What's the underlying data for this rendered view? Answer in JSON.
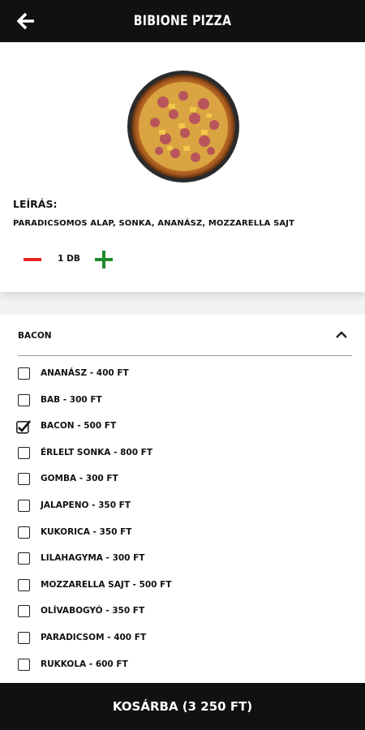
{
  "header": {
    "title": "BIBIONE PIZZA",
    "back_icon": "arrow-left-icon"
  },
  "product": {
    "image_icon": "pizza-photo",
    "description_label": "LEÍRÁS:",
    "description": "PARADICSOMOS ALAP, SONKA, ANANÁSZ, MOZZARELLA SAJT",
    "quantity": "1 DB",
    "minus_color": "#e52421",
    "plus_color": "#1e8a2e"
  },
  "extras": {
    "section_title": "BACON",
    "expanded": true,
    "options": [
      {
        "label": "ANANÁSZ - 400 FT",
        "checked": false
      },
      {
        "label": "BAB - 300 FT",
        "checked": false
      },
      {
        "label": "BACON - 500 FT",
        "checked": true
      },
      {
        "label": "ÉRLELT SONKA - 800 FT",
        "checked": false
      },
      {
        "label": "GOMBA - 300 FT",
        "checked": false
      },
      {
        "label": "JALAPENO - 350 FT",
        "checked": false
      },
      {
        "label": "KUKORICA - 350 FT",
        "checked": false
      },
      {
        "label": "LILAHAGYMA - 300 FT",
        "checked": false
      },
      {
        "label": "MOZZARELLA SAJT - 500 FT",
        "checked": false
      },
      {
        "label": "OLÍVABOGYÓ - 350 FT",
        "checked": false
      },
      {
        "label": "PARADICSOM - 400 FT",
        "checked": false
      },
      {
        "label": "RUKKOLA - 600 FT",
        "checked": false
      }
    ]
  },
  "footer": {
    "cart_button": "KOSÁRBA (3 250 FT)"
  }
}
